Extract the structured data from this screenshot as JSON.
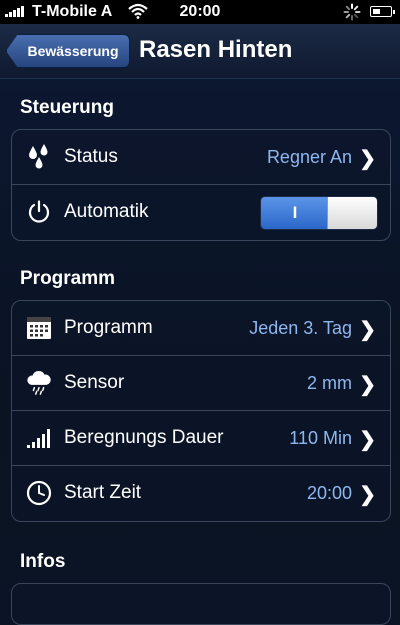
{
  "status_bar": {
    "carrier": "T-Mobile A",
    "time": "20:00",
    "signal_icon": "signal-bars-icon",
    "wifi_icon": "wifi-icon",
    "activity_icon": "activity-spinner-icon",
    "battery_icon": "battery-icon"
  },
  "navbar": {
    "back_label": "Bewässerung",
    "title": "Rasen Hinten"
  },
  "sections": {
    "steuerung": {
      "title": "Steuerung",
      "status": {
        "label": "Status",
        "value": "Regner An",
        "icon": "water-drops-icon"
      },
      "automatik": {
        "label": "Automatik",
        "toggle_label": "I",
        "toggle_on": true,
        "icon": "power-icon"
      }
    },
    "programm": {
      "title": "Programm",
      "programm": {
        "label": "Programm",
        "value": "Jeden 3. Tag",
        "icon": "calendar-icon"
      },
      "sensor": {
        "label": "Sensor",
        "value": "2 mm",
        "icon": "rain-cloud-icon"
      },
      "dauer": {
        "label": "Beregnungs Dauer",
        "value": "110 Min",
        "icon": "bar-levels-icon"
      },
      "start": {
        "label": "Start Zeit",
        "value": "20:00",
        "icon": "clock-icon"
      }
    },
    "infos": {
      "title": "Infos"
    }
  },
  "colors": {
    "value_text": "#8fb7ef",
    "toggle_on": "#3f7fdc",
    "background": "#0b1424"
  }
}
